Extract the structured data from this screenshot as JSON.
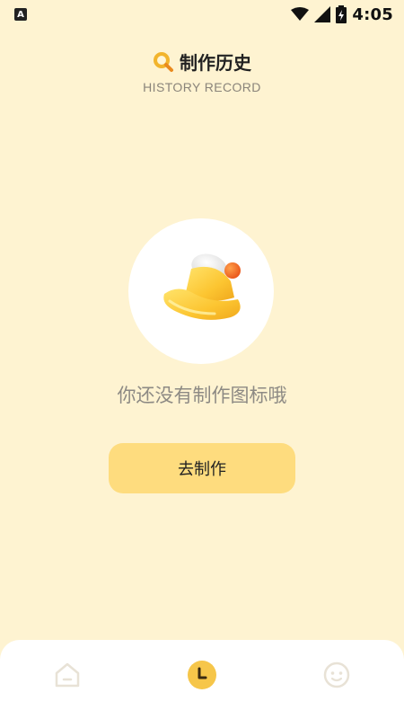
{
  "status_bar": {
    "app_badge": "A",
    "time": "4:05",
    "icons": [
      "wifi-icon",
      "signal-icon",
      "battery-charging-icon"
    ]
  },
  "header": {
    "icon": "search-icon",
    "title": "制作历史",
    "subtitle": "HISTORY RECORD"
  },
  "empty_state": {
    "illustration": "bell-icon",
    "message": "你还没有制作图标哦",
    "action_label": "去制作"
  },
  "bottom_nav": {
    "items": [
      {
        "icon": "home-icon",
        "active": false
      },
      {
        "icon": "history-icon",
        "active": true
      },
      {
        "icon": "face-icon",
        "active": false
      }
    ]
  },
  "colors": {
    "background": "#FEF3D1",
    "button": "#FEDC7E",
    "accent": "#F6C64A",
    "nav_inactive": "#E8E2D6"
  }
}
